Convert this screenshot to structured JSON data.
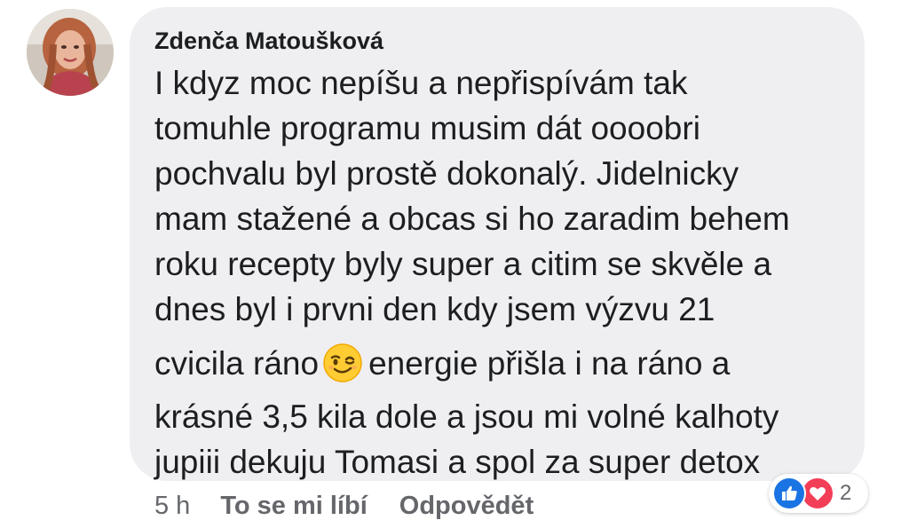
{
  "comment": {
    "author": "Zdenča Matoušková",
    "lines": [
      "I kdyz moc nepíšu a nepřispívám tak",
      "tomuhle programu musim dát oooobri",
      "pochvalu byl prostě dokonalý. Jidelnicky",
      "mam stažené a obcas si ho zaradim behem",
      "roku recepty byly super a citim se skvěle a",
      "dnes byl i prvni den kdy jsem výzvu 21"
    ],
    "emoji_line_before": "cvicila ráno",
    "emoji_icon": "winking-face-emoji",
    "emoji_line_after": "energie přišla i na ráno a",
    "lines_after": [
      "krásné 3,5 kila dole a jsou mi volné kalhoty",
      "jupiii dekuju Tomasi a spol za super detox"
    ]
  },
  "actions": {
    "time": "5 h",
    "like_label": "To se mi líbí",
    "reply_label": "Odpovědět"
  },
  "reactions": {
    "icons": [
      "thumbs-up-icon",
      "heart-icon"
    ],
    "count": "2",
    "colors": {
      "like": "#1b74e4",
      "love": "#f33e58"
    }
  }
}
